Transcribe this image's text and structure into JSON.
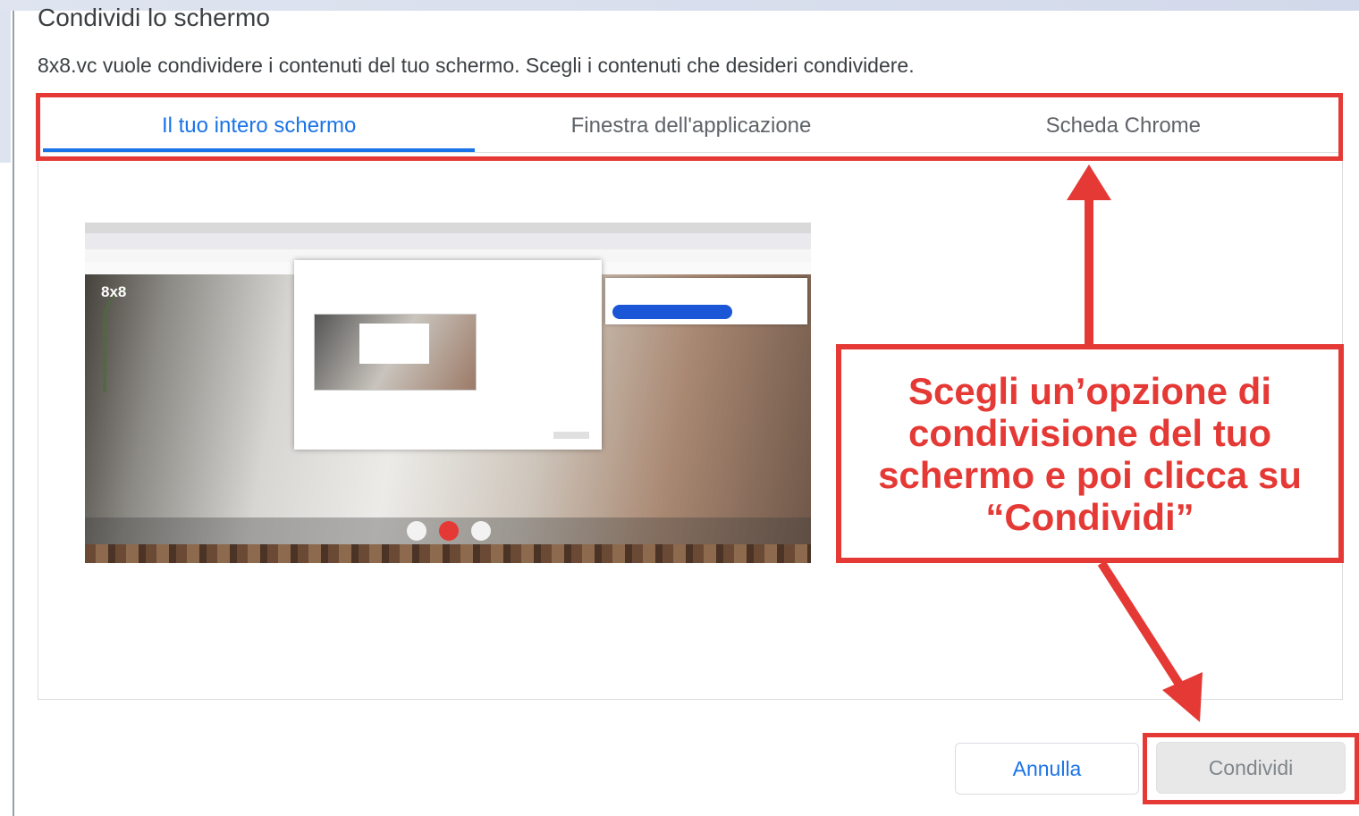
{
  "dialog": {
    "title": "Condividi lo schermo",
    "subtitle": "8x8.vc vuole condividere i contenuti del tuo schermo. Scegli i contenuti che desideri condividere."
  },
  "tabs": [
    {
      "label": "Il tuo intero schermo",
      "active": true
    },
    {
      "label": "Finestra dell'applicazione",
      "active": false
    },
    {
      "label": "Scheda Chrome",
      "active": false
    }
  ],
  "thumbnail": {
    "logo_text": "8x8"
  },
  "annotation": {
    "callout_text": "Scegli un’opzione di condivisione del tuo schermo e poi clicca su “Condividi”"
  },
  "buttons": {
    "cancel": "Annulla",
    "share": "Condividi"
  },
  "colors": {
    "accent_blue": "#1a73e8",
    "annotation_red": "#e53935",
    "text": "#3c4043"
  }
}
